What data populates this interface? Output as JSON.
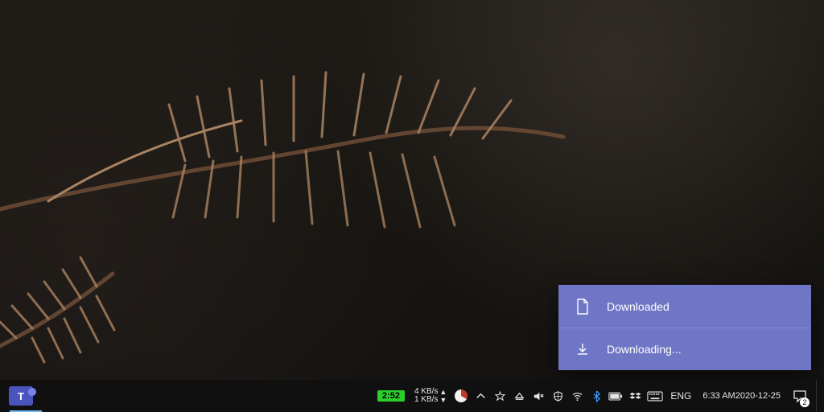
{
  "toasts": [
    {
      "icon": "file-icon",
      "label": "Downloaded"
    },
    {
      "icon": "download-icon",
      "label": "Downloading..."
    }
  ],
  "taskbar": {
    "teams_initial": "T",
    "battery_label": "2:52",
    "net_up": "4 KB/s",
    "net_down": "1 KB/s",
    "language": "ENG",
    "time": "6:33 AM",
    "date": "2020-12-25",
    "notification_count": "2"
  },
  "colors": {
    "toast_bg": "#6f76c5",
    "battery_green": "#2bcf2b"
  }
}
